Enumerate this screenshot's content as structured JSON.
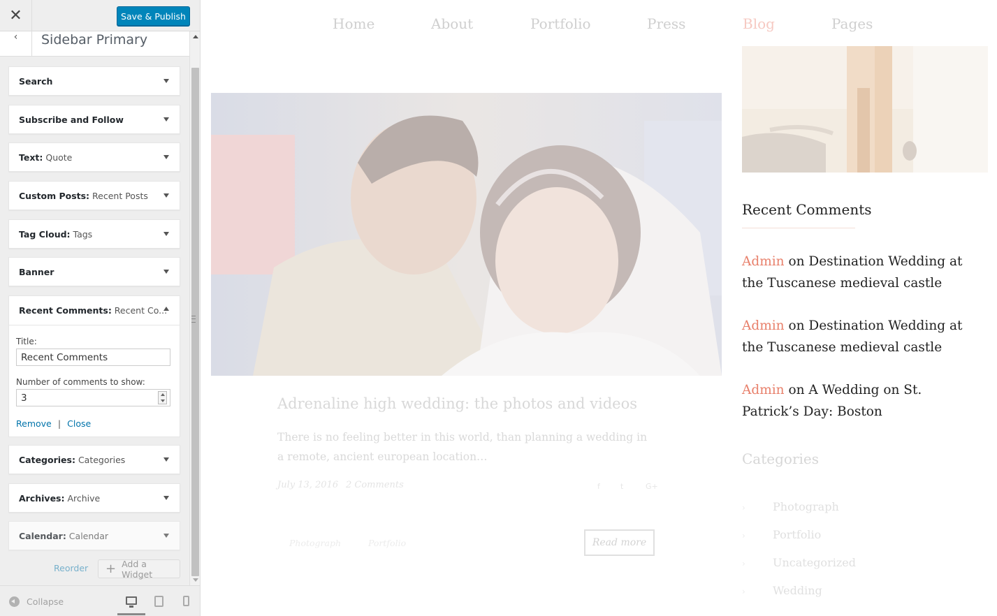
{
  "customizer": {
    "close_icon": "close-icon",
    "publish_label": "Save & Publish",
    "section_title": "Sidebar Primary",
    "widgets": [
      {
        "name": "Search",
        "sub": ""
      },
      {
        "name": "Subscribe and Follow",
        "sub": ""
      },
      {
        "name": "Text:",
        "sub": " Quote"
      },
      {
        "name": "Custom Posts:",
        "sub": " Recent Posts"
      },
      {
        "name": "Tag Cloud:",
        "sub": " Tags"
      },
      {
        "name": "Banner",
        "sub": ""
      },
      {
        "name": "Recent Comments:",
        "sub": " Recent Co..."
      },
      {
        "name": "Categories:",
        "sub": " Categories"
      },
      {
        "name": "Archives:",
        "sub": " Archive"
      },
      {
        "name": "Calendar:",
        "sub": " Calendar"
      }
    ],
    "expanded": {
      "title_label": "Title:",
      "title_value": "Recent Comments",
      "count_label": "Number of comments to show:",
      "count_value": "3",
      "remove_label": "Remove",
      "separator": "|",
      "close_label": "Close"
    },
    "reorder_label": "Reorder",
    "add_widget_label": "Add a Widget",
    "collapse_label": "Collapse"
  },
  "preview": {
    "nav": [
      "Home",
      "About",
      "Portfolio",
      "Press",
      "Blog",
      "Pages"
    ],
    "nav_active": "Blog",
    "post": {
      "title": "Adrenaline high wedding: the photos and videos",
      "excerpt": "There is no feeling better in this world, than planning a wedding in a remote, ancient european location…",
      "date": "July 13, 2016",
      "comments": "2 Comments",
      "share": [
        "f",
        "t",
        "G+"
      ],
      "tags": [
        "Photograph",
        "Portfolio"
      ],
      "read_more": "Read more"
    },
    "sidebar": {
      "recent_comments_heading": "Recent Comments",
      "comments": [
        {
          "author": "Admin",
          "on": " on ",
          "post": "Destination Wedding at the Tuscanese medieval castle"
        },
        {
          "author": "Admin",
          "on": " on ",
          "post": "Destination Wedding at the Tuscanese medieval castle"
        },
        {
          "author": "Admin",
          "on": " on ",
          "post": "A Wedding on St. Patrick’s Day: Boston"
        }
      ],
      "categories_heading": "Categories",
      "categories": [
        "Photograph",
        "Portfolio",
        "Uncategorized",
        "Wedding"
      ]
    }
  },
  "colors": {
    "publish": "#0085ba",
    "link": "#0073aa",
    "author": "#e8806b",
    "nav_active": "#f6c9c2"
  }
}
